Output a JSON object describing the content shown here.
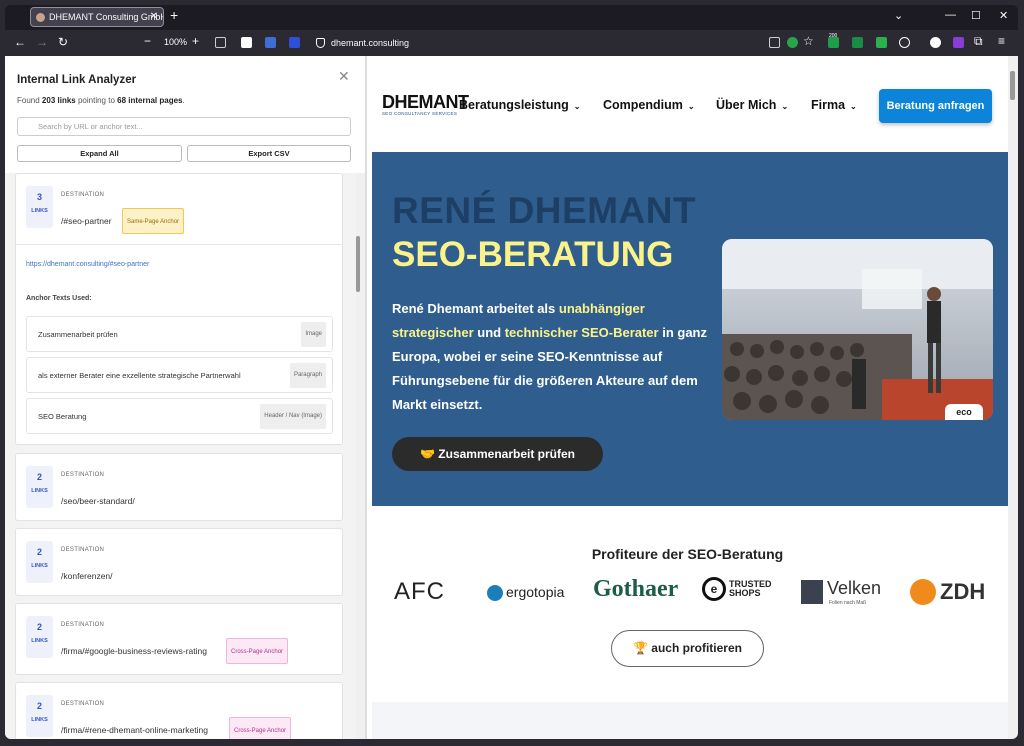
{
  "browser": {
    "tab_title": "DHEMANT Consulting GmbH",
    "zoom": "100%",
    "url": "dhemant.consulting",
    "ext_badge": "200"
  },
  "panel": {
    "title": "Internal Link Analyzer",
    "found_prefix": "Found",
    "found_links": "203 links",
    "found_mid": "pointing to",
    "found_pages": "68 internal pages",
    "search_placeholder": "Search by URL or anchor text...",
    "expand_all": "Expand All",
    "export_csv": "Export CSV",
    "dest_label": "DESTINATION",
    "links_label": "LINKS",
    "anchor_texts_label": "Anchor Texts Used:",
    "cards": [
      {
        "count": "3",
        "path": "/#seo-partner",
        "badge": "Same-Page Anchor",
        "full_url": "https://dhemant.consulting/#seo-partner",
        "anchors": [
          {
            "text": "Zusammenarbeit prüfen",
            "kind": "Image"
          },
          {
            "text": "als externer Berater eine exzellente strategische Partnerwahl",
            "kind": "Paragraph"
          },
          {
            "text": "SEO Beratung",
            "kind": "Header / Nav (Image)"
          }
        ]
      },
      {
        "count": "2",
        "path": "/seo/beer-standard/",
        "badge": ""
      },
      {
        "count": "2",
        "path": "/konferenzen/",
        "badge": ""
      },
      {
        "count": "2",
        "path": "/firma/#google-business-reviews-rating",
        "badge": "Cross-Page Anchor"
      },
      {
        "count": "2",
        "path": "/firma/#rene-dhemant-online-marketing",
        "badge": "Cross-Page Anchor"
      }
    ]
  },
  "site": {
    "logo": "DHEMANT",
    "logo_sub": "SEO CONSULTANCY SERVICES",
    "nav": [
      "Beratungsleistung",
      "Compendium",
      "Über Mich",
      "Firma"
    ],
    "cta": "Beratung anfragen",
    "hero_name": "RENÉ DHEMANT",
    "hero_title": "SEO-BERATUNG",
    "hero_p1": "René Dhemant arbeitet als ",
    "hero_h1": "unabhängiger strategischer",
    "hero_p2": " und ",
    "hero_h2": "technischer SEO-Berater",
    "hero_p3": " in ganz Europa, wobei er seine SEO-Kenntnisse auf Führungsebene für die größeren Akteure auf dem Markt einsetzt.",
    "hero_button": "🤝 Zusammenarbeit prüfen",
    "photo_tag": "eco",
    "profit_title": "Profiteure der SEO-Beratung",
    "logos": [
      "AFC",
      "ergotopia",
      "Gothaer",
      "TRUSTED SHOPS",
      "Velken",
      "ZDH"
    ],
    "logo_velken_sub": "Folien nach Maß",
    "profit_button": "🏆 auch profitieren"
  },
  "colors": {
    "hero_bg": "#2f5e8e",
    "accent_yellow": "#fbf38a",
    "cta_blue": "#0b84d9",
    "link_blue": "#3356c4"
  }
}
